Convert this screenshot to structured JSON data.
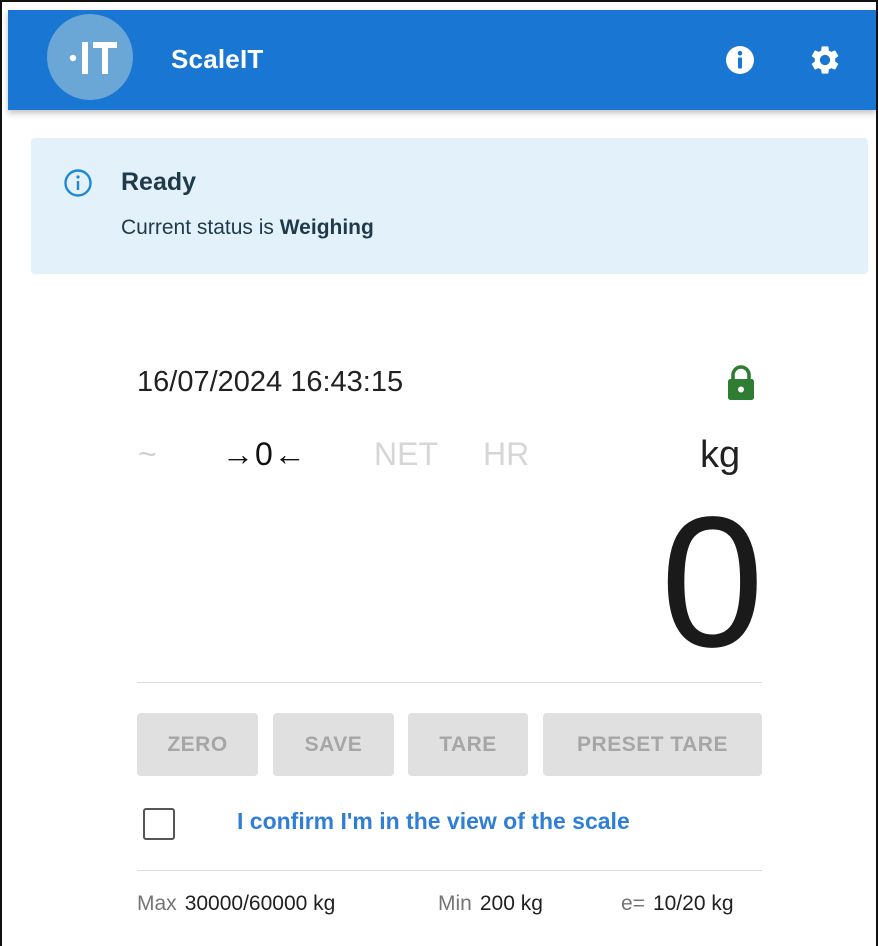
{
  "app": {
    "title": "ScaleIT",
    "logo_text": "·IT"
  },
  "header_icons": {
    "info": "info-icon",
    "settings": "gear-icon"
  },
  "alert": {
    "icon": "info-outline-icon",
    "title": "Ready",
    "body_prefix": "Current status is ",
    "status": "Weighing"
  },
  "scale": {
    "datetime": "16/07/2024 16:43:15",
    "lock_icon": "lock-icon",
    "lock_color": "#2e7d32",
    "indicators": {
      "stable": "~",
      "zero": "→0←",
      "net": "NET",
      "hr": "HR"
    },
    "unit": "kg",
    "weight": "0"
  },
  "buttons": {
    "zero": "ZERO",
    "save": "SAVE",
    "tare": "TARE",
    "preset_tare": "PRESET TARE"
  },
  "confirm": {
    "label": "I confirm I'm in the view of the scale",
    "checked": false
  },
  "specs": {
    "max_label": "Max",
    "max_value": "30000/60000 kg",
    "min_label": "Min",
    "min_value": "200 kg",
    "e_label": "e=",
    "e_value": "10/20 kg"
  },
  "colors": {
    "primary": "#1976d2",
    "alert_bg": "#e3f2fa",
    "link": "#2f7fd6"
  }
}
